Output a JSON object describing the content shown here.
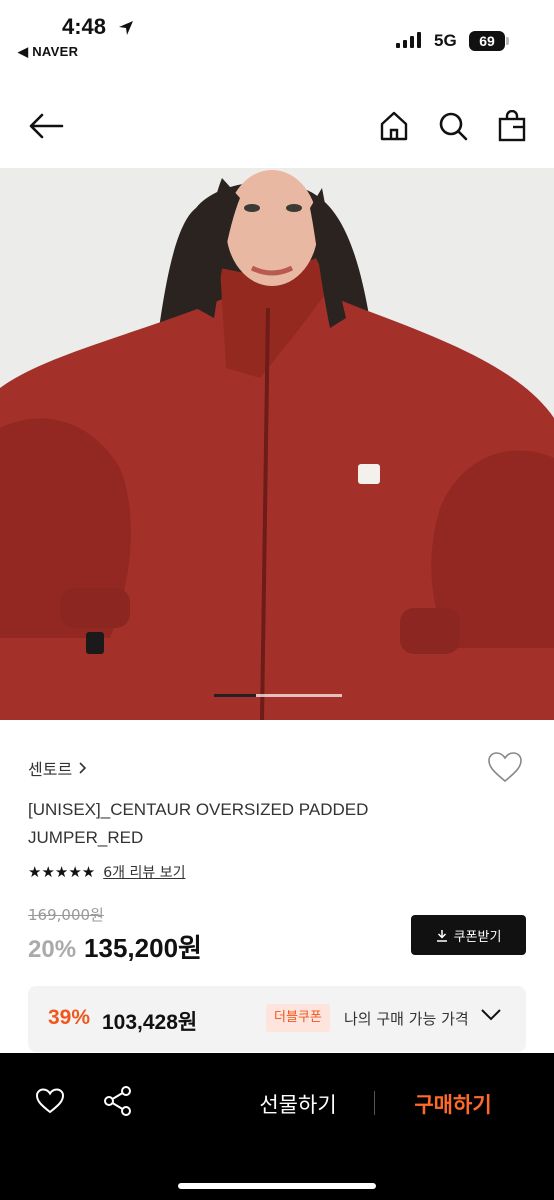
{
  "status_bar": {
    "time": "4:48",
    "back_app": "◀ NAVER",
    "network": "5G",
    "battery": "69"
  },
  "nav": {
    "back_icon": "arrow-left-icon",
    "home_icon": "home-icon",
    "search_icon": "search-icon",
    "bag_icon": "shopping-bag-icon"
  },
  "hero": {
    "jacket_color": "#a4302a",
    "pager_total": 3,
    "pager_active": 1
  },
  "product": {
    "brand": "센토르",
    "title": "[UNISEX]_CENTAUR OVERSIZED PADDED JUMPER_RED",
    "rating": 4.5,
    "stars_text": "★★★★★",
    "review_link": "6개 리뷰 보기",
    "original_price": "169,000원",
    "discount": "20%",
    "price": "135,200원",
    "coupon_button": "쿠폰받기"
  },
  "my_price": {
    "discount": "39%",
    "price": "103,428원",
    "badge": "더블쿠폰",
    "label": "나의 구매 가능 가격"
  },
  "bottom_bar": {
    "gift": "선물하기",
    "buy": "구매하기"
  },
  "colors": {
    "accent": "#f0571e",
    "buy": "#ff6a2b",
    "bar_bg": "#000000"
  }
}
